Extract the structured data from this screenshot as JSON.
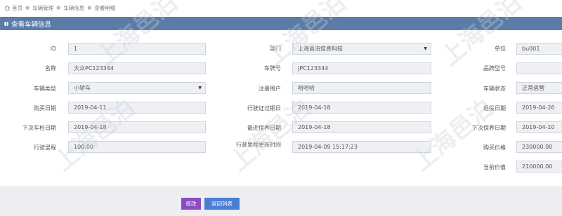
{
  "breadcrumb": [
    "首页",
    "车辆管理",
    "车辆信息",
    "查看明细"
  ],
  "panel_title": "查看车辆信息",
  "fields": [
    {
      "label": "ID",
      "value": "1"
    },
    {
      "label": "部门",
      "value": "上海邑泊信息科技"
    },
    {
      "label": "单位",
      "value": "bu001"
    },
    {
      "label": "名称",
      "value": "大众PC123344"
    },
    {
      "label": "车牌号",
      "value": "JPC123344"
    },
    {
      "label": "品牌型号",
      "value": ""
    },
    {
      "label": "车辆类型",
      "value": "小轿车"
    },
    {
      "label": "注册用户",
      "value": "哈哈哈"
    },
    {
      "label": "车辆状态",
      "value": "正常运营"
    },
    {
      "label": "购买日期",
      "value": "2019-04-11"
    },
    {
      "label": "行驶证过期日",
      "value": "2019-04-18"
    },
    {
      "label": "退役日期",
      "value": "2019-04-26"
    },
    {
      "label": "下次车检日期",
      "value": "2019-04-18"
    },
    {
      "label": "最近保养日期",
      "value": "2019-04-18"
    },
    {
      "label": "下次保养日期",
      "value": "2019-04-10"
    },
    {
      "label": "行驶里程",
      "value": "100.00"
    },
    {
      "label": "行驶里程更新时间",
      "value": "2019-04-09 15:17:23"
    },
    {
      "label": "购买价格",
      "value": "230000.00"
    },
    {
      "label": "当前价值",
      "value": "210000.00"
    }
  ],
  "buttons": {
    "edit": "修改",
    "back": "返回列表"
  },
  "watermark": "上海邑泊"
}
